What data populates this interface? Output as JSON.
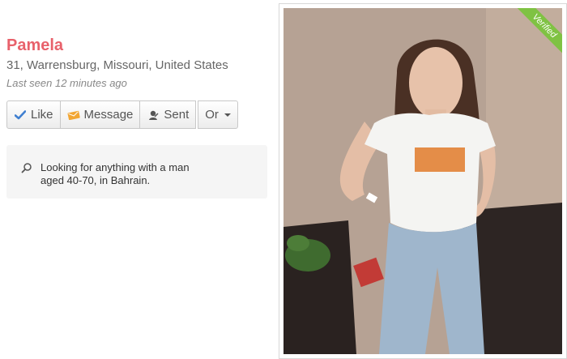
{
  "profile": {
    "name": "Pamela",
    "location": "31, Warrensburg, Missouri, United States",
    "last_seen": "Last seen 12 minutes ago",
    "looking_for": "Looking for anything with a man aged 40-70, in Bahrain.",
    "verified_label": "Verified"
  },
  "actions": {
    "like": "Like",
    "message": "Message",
    "sent": "Sent",
    "or": "Or"
  },
  "icons": {
    "like": "check-icon",
    "message": "envelope-icon",
    "sent": "sent-icon",
    "or": "caret-down-icon",
    "search": "search-icon"
  },
  "colors": {
    "name": "#e8616b",
    "verified": "#7fc243",
    "like_check": "#3f7fd0",
    "message_icon": "#f2a633"
  }
}
